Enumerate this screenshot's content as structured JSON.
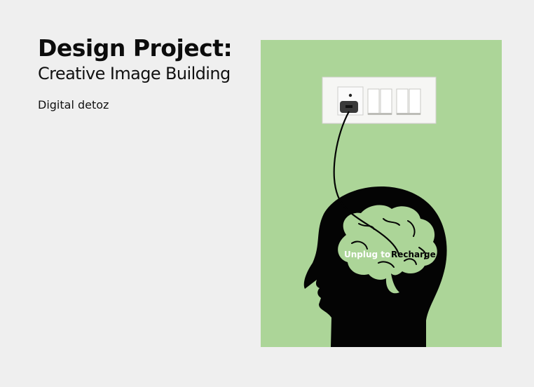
{
  "header": {
    "title": "Design Project:",
    "subtitle": "Creative Image Building",
    "caption": "Digital detoz"
  },
  "poster": {
    "background_color": "#acd598",
    "silhouette_color": "#040404",
    "brain_color": "#acd598",
    "slogan_part1": "Unplug to",
    "slogan_part2": "Recharge",
    "slogan_part1_color": "#ffffff",
    "slogan_part2_color": "#040404"
  }
}
